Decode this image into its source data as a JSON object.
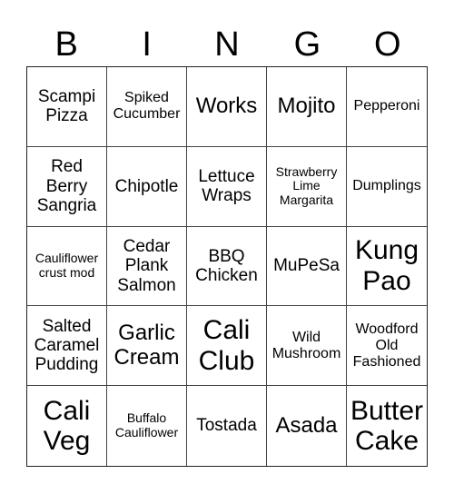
{
  "title": {
    "letters": [
      "B",
      "I",
      "N",
      "G",
      "O"
    ]
  },
  "board": {
    "cells": [
      {
        "text": "Scampi Pizza",
        "size": "md"
      },
      {
        "text": "Spiked Cucumber",
        "size": "sm"
      },
      {
        "text": "Works",
        "size": "lg"
      },
      {
        "text": "Mojito",
        "size": "lg"
      },
      {
        "text": "Pepperoni",
        "size": "sm"
      },
      {
        "text": "Red Berry Sangria",
        "size": "md"
      },
      {
        "text": "Chipotle",
        "size": "md"
      },
      {
        "text": "Lettuce Wraps",
        "size": "md"
      },
      {
        "text": "Strawberry Lime Margarita",
        "size": "xs"
      },
      {
        "text": "Dumplings",
        "size": "sm"
      },
      {
        "text": "Cauliflower crust mod",
        "size": "xs"
      },
      {
        "text": "Cedar Plank Salmon",
        "size": "md"
      },
      {
        "text": "BBQ Chicken",
        "size": "md"
      },
      {
        "text": "MuPeSa",
        "size": "md"
      },
      {
        "text": "Kung Pao",
        "size": "xl"
      },
      {
        "text": "Salted Caramel Pudding",
        "size": "md"
      },
      {
        "text": "Garlic Cream",
        "size": "lg"
      },
      {
        "text": "Cali Club",
        "size": "xl"
      },
      {
        "text": "Wild Mushroom",
        "size": "sm"
      },
      {
        "text": "Woodford Old Fashioned",
        "size": "sm"
      },
      {
        "text": "Cali Veg",
        "size": "xl"
      },
      {
        "text": "Buffalo Cauliflower",
        "size": "xs"
      },
      {
        "text": "Tostada",
        "size": "md"
      },
      {
        "text": "Asada",
        "size": "lg"
      },
      {
        "text": "Butter Cake",
        "size": "xl"
      }
    ]
  }
}
